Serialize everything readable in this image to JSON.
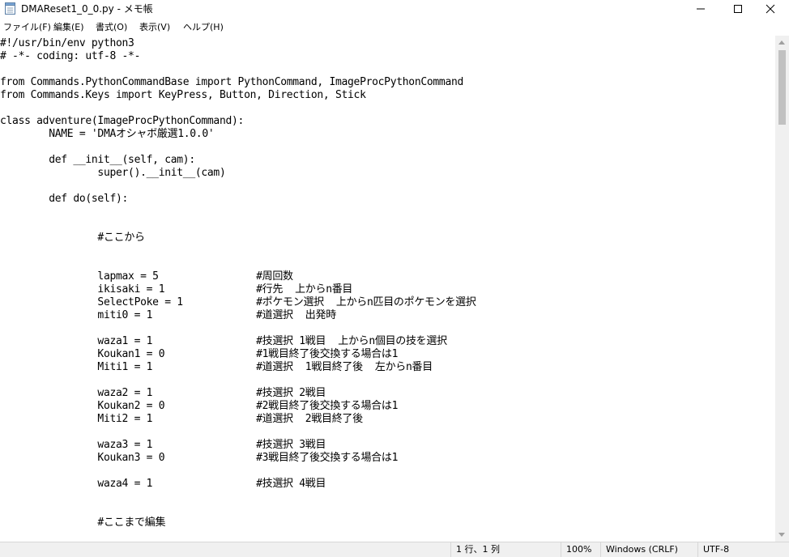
{
  "window": {
    "title": "DMAReset1_0_0.py - メモ帳"
  },
  "menu": [
    {
      "label": "ファイル(F)"
    },
    {
      "label": "編集(E)"
    },
    {
      "label": "書式(O)"
    },
    {
      "label": "表示(V)"
    },
    {
      "label": "ヘルプ(H)"
    }
  ],
  "code_lines": [
    "#!/usr/bin/env python3",
    "# -*- coding: utf-8 -*-",
    "",
    "from Commands.PythonCommandBase import PythonCommand, ImageProcPythonCommand",
    "from Commands.Keys import KeyPress, Button, Direction, Stick",
    "",
    "class adventure(ImageProcPythonCommand):",
    "        NAME = 'DMAオシャボ厳選1.0.0'",
    "",
    "        def __init__(self, cam):",
    "                super().__init__(cam)",
    "",
    "        def do(self):",
    "",
    "",
    "                #ここから",
    "",
    "",
    "                lapmax = 5                #周回数",
    "                ikisaki = 1               #行先  上からn番目",
    "                SelectPoke = 1            #ポケモン選択  上からn匹目のポケモンを選択",
    "                miti0 = 1                 #道選択  出発時",
    "",
    "                waza1 = 1                 #技選択 1戦目  上からn個目の技を選択",
    "                Koukan1 = 0               #1戦目終了後交換する場合は1",
    "                Miti1 = 1                 #道選択  1戦目終了後  左からn番目",
    "",
    "                waza2 = 1                 #技選択 2戦目",
    "                Koukan2 = 0               #2戦目終了後交換する場合は1",
    "                Miti2 = 1                 #道選択  2戦目終了後",
    "",
    "                waza3 = 1                 #技選択 3戦目",
    "                Koukan3 = 0               #3戦目終了後交換する場合は1",
    "",
    "                waza4 = 1                 #技選択 4戦目",
    "",
    "",
    "                #ここまで編集"
  ],
  "status": {
    "position": "1 行、1 列",
    "zoom": "100%",
    "line_ending": "Windows (CRLF)",
    "encoding": "UTF-8"
  }
}
